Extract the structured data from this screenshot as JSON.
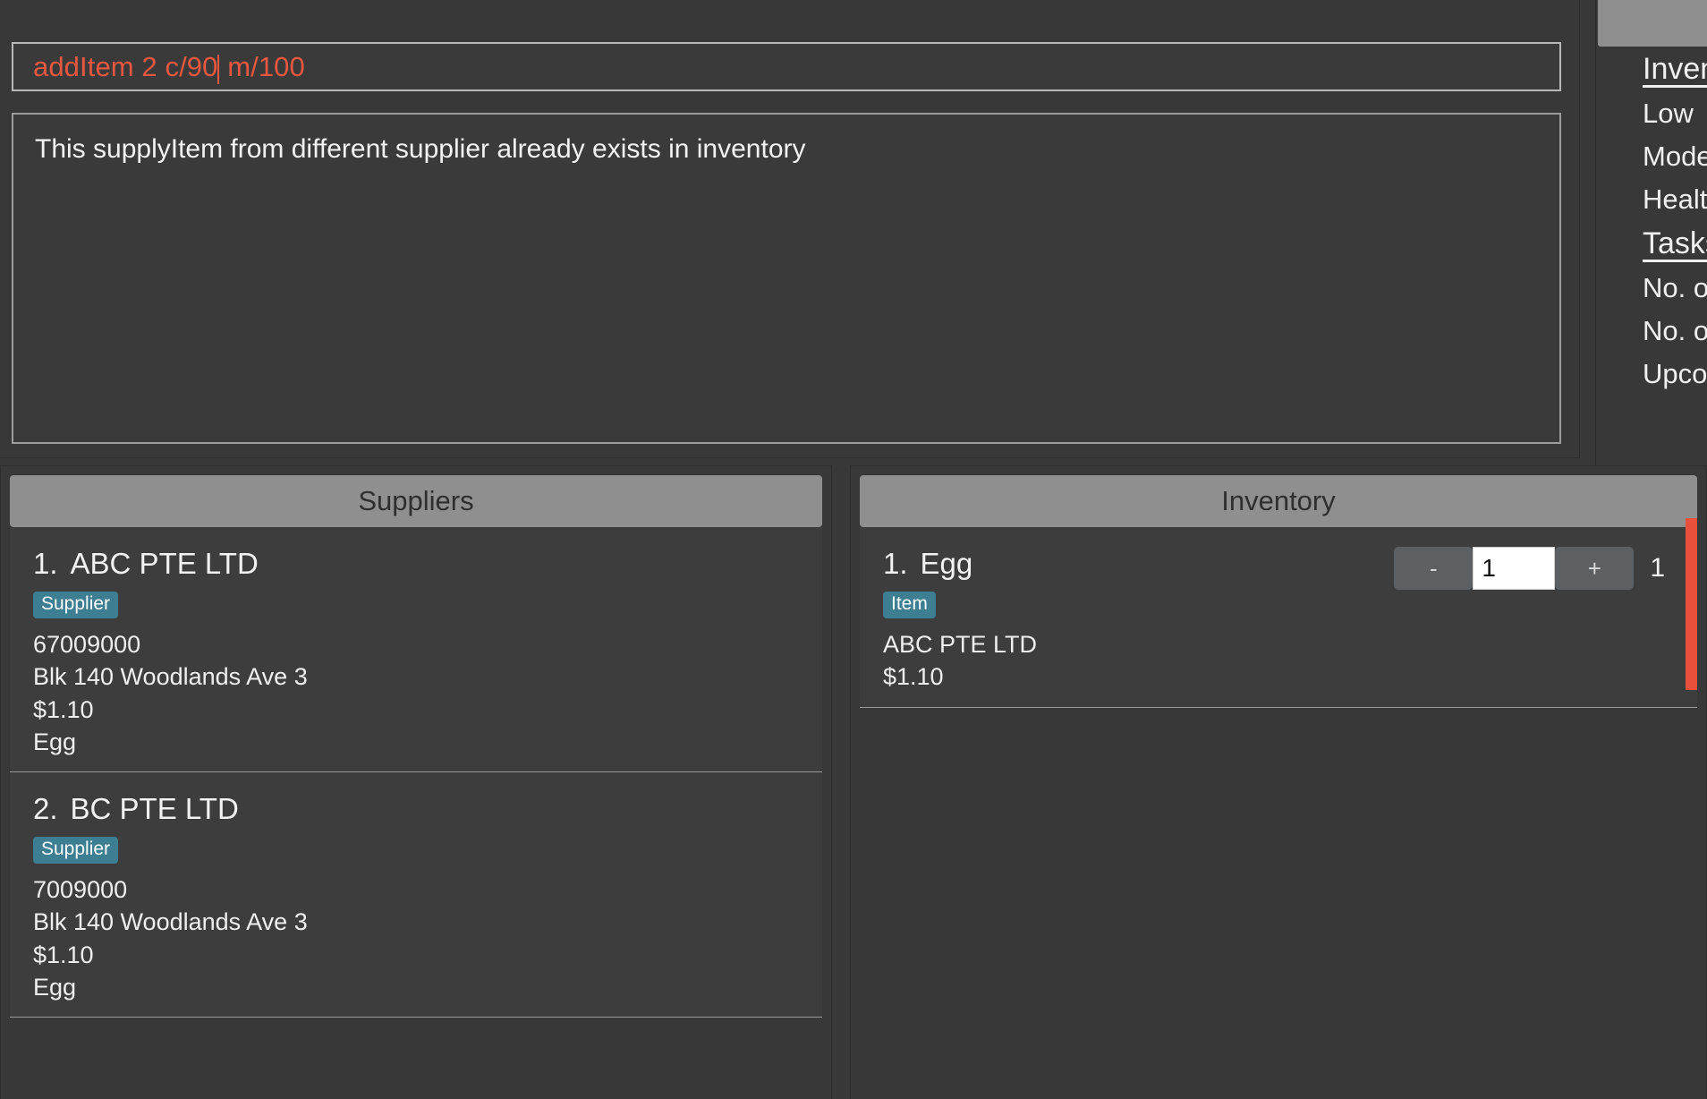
{
  "command": {
    "value_before_caret": "addItem 2 c/90",
    "value_after_caret": " m/100",
    "full_value": "addItem 2 c/90 m/100",
    "accent_color": "#e8573f"
  },
  "result": {
    "message": "This supplyItem from different supplier already exists in inventory"
  },
  "status_panel": {
    "inventory_heading": "Inventory",
    "lines": [
      "Low",
      "Moderate",
      "Healthy"
    ],
    "tasks_heading": "Tasks",
    "task_lines": [
      "No. of",
      "No. of",
      "Upcoming"
    ]
  },
  "suppliers_panel": {
    "title": "Suppliers",
    "items": [
      {
        "index": "1.",
        "name": "ABC PTE LTD",
        "badge": "Supplier",
        "phone": "67009000",
        "address": "Blk 140 Woodlands Ave 3",
        "price": "$1.10",
        "product": "Egg"
      },
      {
        "index": "2.",
        "name": "BC PTE LTD",
        "badge": "Supplier",
        "phone": "7009000",
        "address": "Blk 140 Woodlands Ave 3",
        "price": "$1.10",
        "product": "Egg"
      }
    ]
  },
  "inventory_panel": {
    "title": "Inventory",
    "items": [
      {
        "index": "1.",
        "name": "Egg",
        "badge": "Item",
        "supplier": "ABC PTE LTD",
        "price": "$1.10",
        "stepper": {
          "decrement_label": "-",
          "quantity": "1",
          "increment_label": "+"
        },
        "count": "1",
        "stock_bar_color": "#e8503c"
      }
    ]
  },
  "colors": {
    "background": "#383838",
    "panel_header": "#8f8f8f",
    "badge": "#3d7e92",
    "accent_red": "#e8503c"
  }
}
